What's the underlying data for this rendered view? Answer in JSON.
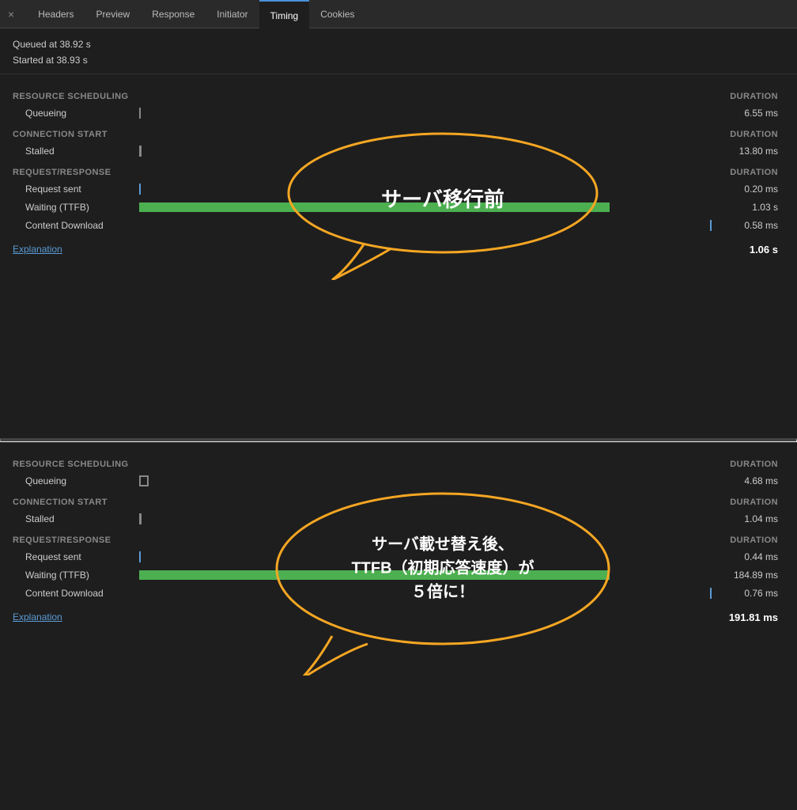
{
  "tabs": {
    "close_label": "×",
    "items": [
      {
        "label": "Headers",
        "active": false
      },
      {
        "label": "Preview",
        "active": false
      },
      {
        "label": "Response",
        "active": false
      },
      {
        "label": "Initiator",
        "active": false
      },
      {
        "label": "Timing",
        "active": true
      },
      {
        "label": "Cookies",
        "active": false
      }
    ]
  },
  "panel1": {
    "queued": "Queued at 38.92 s",
    "started": "Started at 38.93 s",
    "sections": [
      {
        "header": "Resource Scheduling",
        "duration_label": "DURATION",
        "rows": [
          {
            "label": "Queueing",
            "bar_type": "tick",
            "duration": "6.55 ms"
          }
        ]
      },
      {
        "header": "Connection Start",
        "duration_label": "DURATION",
        "rows": [
          {
            "label": "Stalled",
            "bar_type": "gray",
            "duration": "13.80 ms"
          }
        ]
      },
      {
        "header": "Request/Response",
        "duration_label": "DURATION",
        "rows": [
          {
            "label": "Request sent",
            "bar_type": "blue",
            "duration": "0.20 ms"
          },
          {
            "label": "Waiting (TTFB)",
            "bar_type": "green",
            "bar_width": "82%",
            "duration": "1.03 s"
          },
          {
            "label": "Content Download",
            "bar_type": "blue_right",
            "duration": "0.58 ms"
          }
        ]
      }
    ],
    "explanation_label": "Explanation",
    "total": "1.06 s",
    "bubble_text": "サーバ移行前"
  },
  "panel2": {
    "sections": [
      {
        "header": "Resource Scheduling",
        "duration_label": "DURATION",
        "rows": [
          {
            "label": "Queueing",
            "bar_type": "box",
            "duration": "4.68 ms"
          }
        ]
      },
      {
        "header": "Connection Start",
        "duration_label": "DURATION",
        "rows": [
          {
            "label": "Stalled",
            "bar_type": "gray",
            "duration": "1.04 ms"
          }
        ]
      },
      {
        "header": "Request/Response",
        "duration_label": "DURATION",
        "rows": [
          {
            "label": "Request sent",
            "bar_type": "blue",
            "duration": "0.44 ms"
          },
          {
            "label": "Waiting (TTFB)",
            "bar_type": "green",
            "bar_width": "82%",
            "duration": "184.89 ms"
          },
          {
            "label": "Content Download",
            "bar_type": "blue_right2",
            "duration": "0.76 ms"
          }
        ]
      }
    ],
    "explanation_label": "Explanation",
    "total": "191.81 ms",
    "bubble_text_line1": "サーバ載せ替え後、",
    "bubble_text_line2": "TTFB（初期応答速度）が",
    "bubble_text_line3": "５倍に！"
  },
  "colors": {
    "accent": "#f5a623",
    "green": "#4caf50",
    "blue": "#5b9bd5",
    "bg": "#1e1e1e",
    "section_header": "#888"
  }
}
